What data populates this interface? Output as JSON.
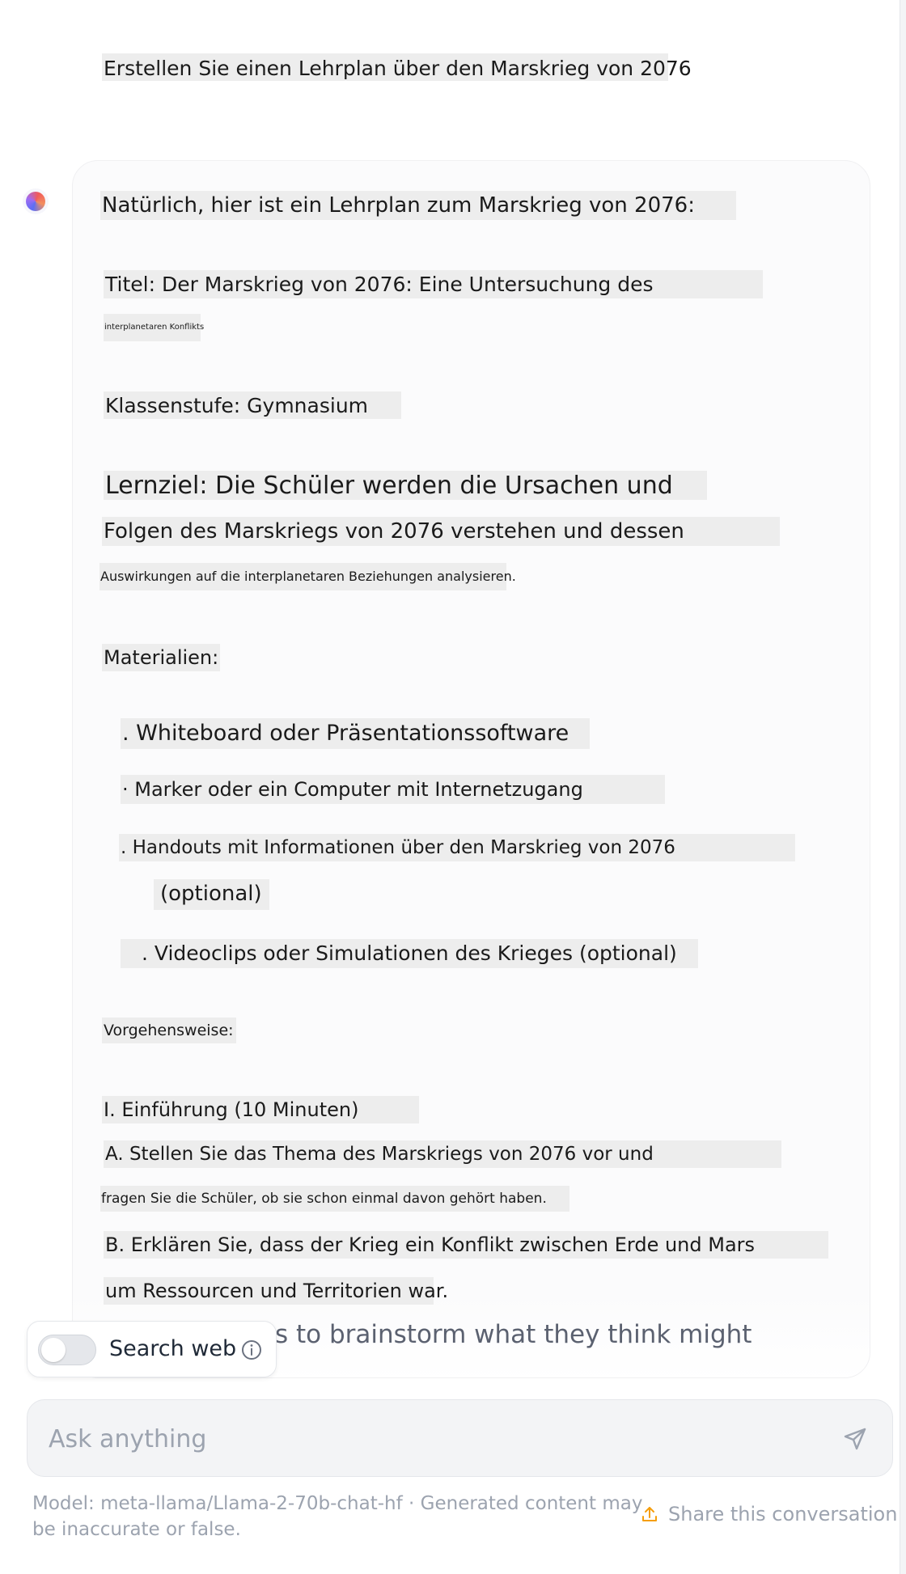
{
  "conversation": {
    "user_message": "Erstellen Sie einen Lehrplan über den Marskrieg von 2076",
    "assistant": {
      "intro": "Natürlich, hier ist ein Lehrplan zum Marskrieg von 2076:",
      "title_line1": "Titel: Der Marskrieg von 2076: Eine Untersuchung des",
      "title_line2": "interplanetaren Konflikts",
      "grade_level": "Klassenstufe: Gymnasium",
      "objective_line1": "Lernziel: Die Schüler werden die Ursachen und",
      "objective_line2": "Folgen des Marskriegs von 2076 verstehen und dessen",
      "objective_line3": "Auswirkungen auf die interplanetaren Beziehungen analysieren.",
      "materials_heading": "Materialien:",
      "materials": [
        ". Whiteboard oder Präsentationssoftware",
        "· Marker oder ein Computer mit Internetzugang",
        ". Handouts mit Informationen über den Marskrieg von 2076",
        "(optional)",
        ". Videoclips oder Simulationen des Krieges (optional)"
      ],
      "procedure_heading": "Vorgehensweise:",
      "section1_heading": "I. Einführung (10 Minuten)",
      "step_a_line1": "A. Stellen Sie das Thema des Marskriegs von 2076 vor und",
      "step_a_line2": "fragen Sie die Schüler, ob sie schon einmal davon gehört haben.",
      "step_b_line1": "B. Erklären Sie, dass der Krieg ein Konflikt zwischen Erde und Mars",
      "step_b_line2": "um Ressourcen und Territorien war.",
      "truncated_line": "s to brainstorm what they think might"
    }
  },
  "search_toggle": {
    "label": "Search web",
    "enabled": false
  },
  "input": {
    "placeholder": "Ask anything",
    "value": ""
  },
  "footer": {
    "disclaimer": "Model: meta-llama/Llama-2-70b-chat-hf · Generated content may be inaccurate or false.",
    "share_label": "Share this conversation"
  },
  "icons": {
    "info": "info-icon",
    "send": "send-icon",
    "share": "share-icon",
    "avatar": "assistant-avatar-icon"
  },
  "colors": {
    "highlight": "#ededed",
    "share_icon": "#f59e0b",
    "muted_text": "#9ca3af"
  }
}
